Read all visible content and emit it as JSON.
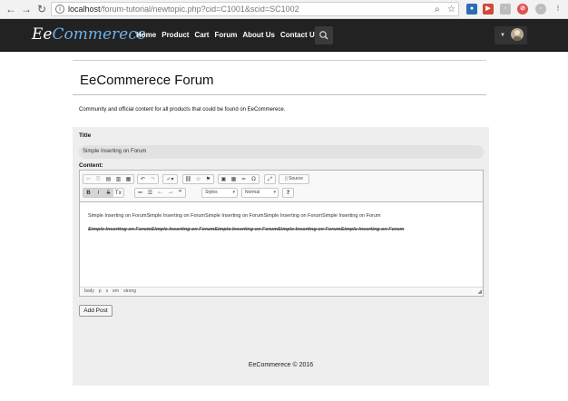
{
  "browser": {
    "url_host": "localhost",
    "url_path": "/forum-tutorial/newtopic.php?cid=C1001&scid=SC1002",
    "icons": [
      "back-icon",
      "forward-icon",
      "reload-icon",
      "page-info-icon",
      "zoom-icon",
      "star-icon"
    ]
  },
  "navbar": {
    "brand_part1": "Ee",
    "brand_part2": "Commerece",
    "links": [
      "Home",
      "Product",
      "Cart",
      "Forum",
      "About Us",
      "Contact Us"
    ]
  },
  "page": {
    "title": "EeCommerece Forum",
    "lead": "Community and official content for all products that could be found on EeCommerece."
  },
  "form": {
    "title_label": "Title",
    "title_value": "Simple Inserting on Forum",
    "content_label": "Content:",
    "source_label": "Source",
    "styles_label": "Styles",
    "format_label": "Normal",
    "paragraph_1": "Simple Inserting on ForumSimple Inserting on ForumSimple Inserting on ForumSimple Inserting on ForumSimple Inserting on Forum",
    "paragraph_2": "Simple Inserting on ForumSimple Inserting on ForumSimple Inserting on ForumSimple Inserting on ForumSimple Inserting on Forum",
    "elements_path": [
      "body",
      "p",
      "s",
      "em",
      "strong"
    ],
    "submit_label": "Add Post"
  },
  "footer": {
    "text": "EeCommerece © 2016"
  }
}
